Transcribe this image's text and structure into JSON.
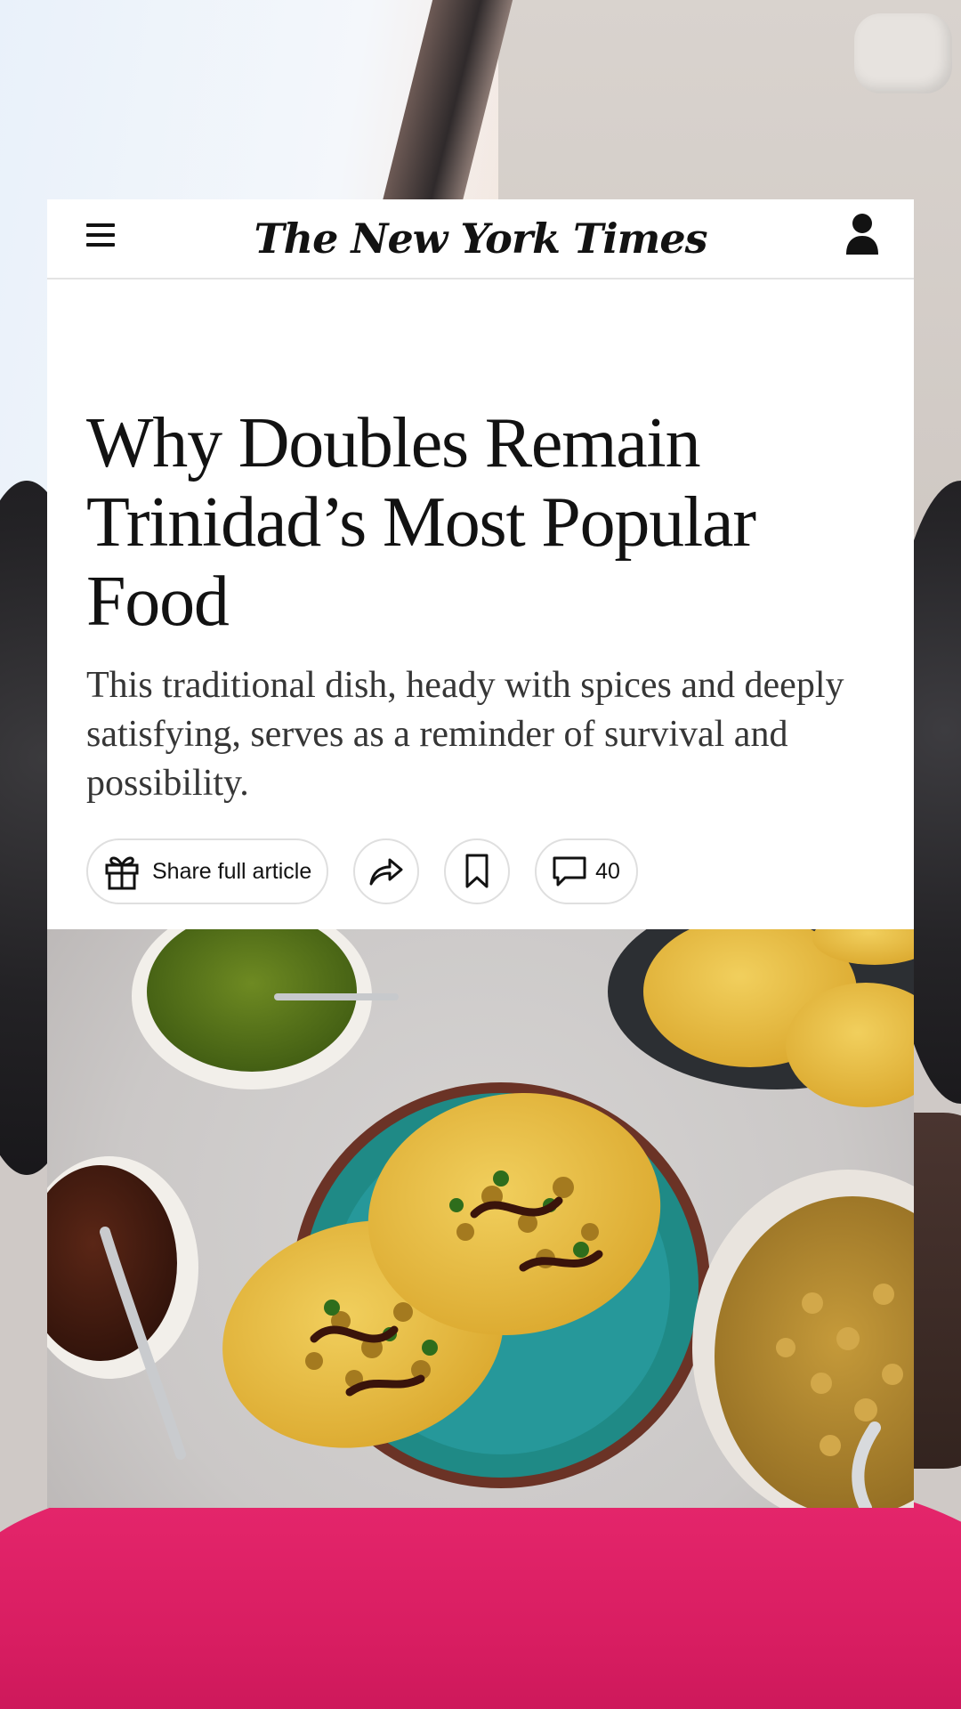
{
  "masthead": {
    "logo": "The New York Times"
  },
  "article": {
    "headline": "Why Doubles Remain Trinidad’s Most Popular Food",
    "summary": "This traditional dish, heady with spices and deeply satisfying, serves as a reminder of survival and possibility."
  },
  "actions": {
    "gift_label": "Share full article",
    "comment_count": "40"
  },
  "icons": {
    "menu": "hamburger-menu-icon",
    "account": "person-icon",
    "gift": "gift-icon",
    "share": "share-arrow-icon",
    "save": "bookmark-icon",
    "comments": "speech-bubble-icon"
  }
}
